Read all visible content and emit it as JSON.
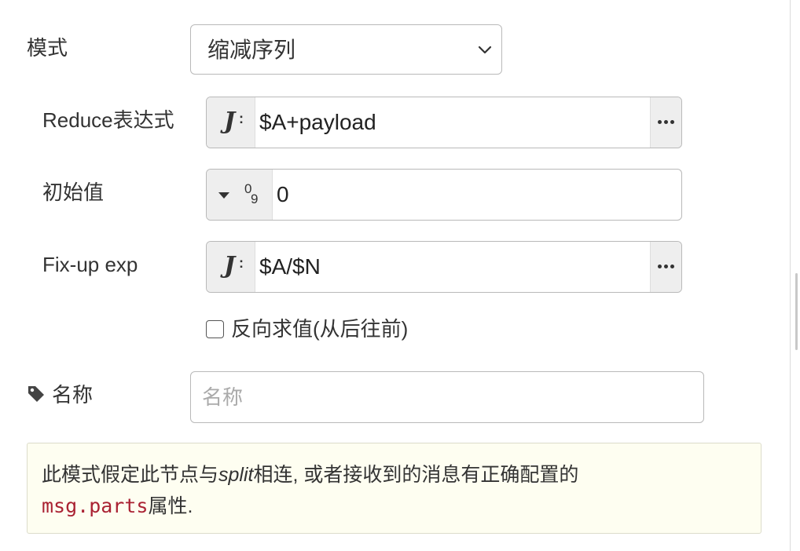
{
  "mode": {
    "label": "模式",
    "selected": "缩减序列",
    "icon": "chevron-down-icon"
  },
  "reduce": {
    "label": "Reduce表达式",
    "type_icon": "jsonata-icon",
    "type_icon_letter": "J",
    "value": "$A+payload"
  },
  "initial": {
    "label": "初始值",
    "type_icon": "number-type-icon",
    "type_sup": "0",
    "type_sub": "9",
    "value": "0"
  },
  "fixup": {
    "label": "Fix-up exp",
    "type_icon": "jsonata-icon",
    "type_icon_letter": "J",
    "value": "$A/$N"
  },
  "reverse": {
    "label": "反向求值(从后往前)",
    "checked": false
  },
  "name": {
    "label": "名称",
    "icon": "tag-icon",
    "placeholder": "名称",
    "value": ""
  },
  "tip": {
    "text_before": "此模式假定此节点与",
    "italic": "split",
    "text_middle": "相连, 或者接收到的消息有正确配置的",
    "code": "msg.parts",
    "text_after": "属性."
  },
  "colors": {
    "border": "#b9b9b9",
    "type_button_bg": "#eeeeee",
    "tip_bg": "#fefef1",
    "tip_border": "#dcdcca",
    "code": "#aa2233"
  }
}
